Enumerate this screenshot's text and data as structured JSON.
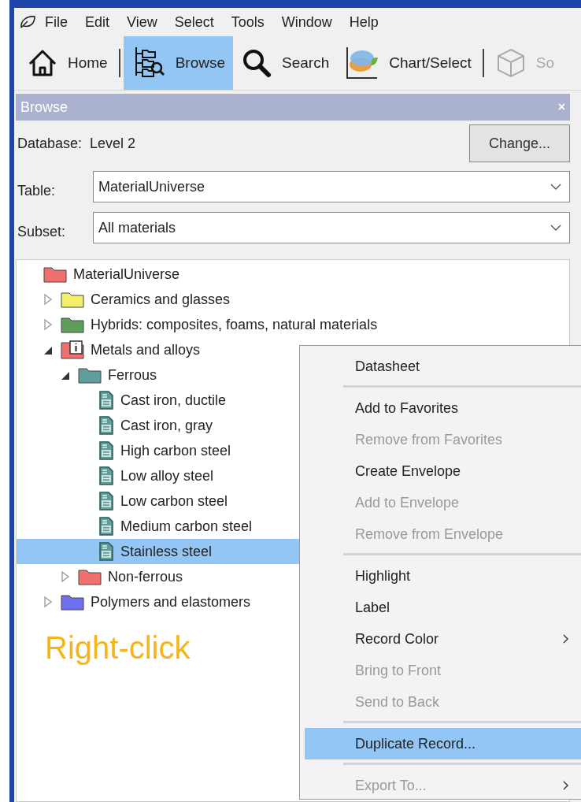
{
  "menu_bar": [
    "File",
    "Edit",
    "View",
    "Select",
    "Tools",
    "Window",
    "Help"
  ],
  "toolbar": [
    {
      "kind": "home",
      "label": "Home",
      "selected": false,
      "disabled": false,
      "divider_after": true
    },
    {
      "kind": "browse",
      "label": "Browse",
      "selected": true,
      "disabled": false,
      "divider_after": false
    },
    {
      "kind": "search",
      "label": "Search",
      "selected": false,
      "disabled": false,
      "divider_after": false
    },
    {
      "kind": "chart",
      "label": "Chart/Select",
      "selected": false,
      "disabled": false,
      "divider_after": true
    },
    {
      "kind": "cube",
      "label": "So",
      "selected": false,
      "disabled": true,
      "divider_after": false
    }
  ],
  "panel": {
    "title": "Browse",
    "close": "×",
    "database_label": "Database:",
    "database_value": "Level 2",
    "change_button": "Change...",
    "table_label": "Table:",
    "table_value": "MaterialUniverse",
    "subset_label": "Subset:",
    "subset_value": "All materials"
  },
  "tree": [
    {
      "label": "MaterialUniverse",
      "kind": "folder",
      "color": "#f07070",
      "selected": false,
      "children": [
        {
          "label": "Ceramics and glasses",
          "kind": "folder",
          "color": "#f3ef6a",
          "selected": false,
          "expanded": false
        },
        {
          "label": "Hybrids: composites, foams, natural materials",
          "kind": "folder",
          "color": "#5f9e5a",
          "selected": false,
          "expanded": false
        },
        {
          "label": "Metals and alloys",
          "kind": "info-folder",
          "color": "#f07070",
          "selected": false,
          "expanded": true,
          "children": [
            {
              "label": "Ferrous",
              "kind": "folder",
              "color": "#5f9e9a",
              "selected": false,
              "expanded": true,
              "children": [
                {
                  "label": "Cast iron, ductile",
                  "kind": "record",
                  "selected": false
                },
                {
                  "label": "Cast iron, gray",
                  "kind": "record",
                  "selected": false
                },
                {
                  "label": "High carbon steel",
                  "kind": "record",
                  "selected": false
                },
                {
                  "label": "Low alloy steel",
                  "kind": "record",
                  "selected": false
                },
                {
                  "label": "Low carbon steel",
                  "kind": "record",
                  "selected": false
                },
                {
                  "label": "Medium carbon steel",
                  "kind": "record",
                  "selected": false
                },
                {
                  "label": "Stainless steel",
                  "kind": "record",
                  "selected": true
                }
              ]
            },
            {
              "label": "Non-ferrous",
              "kind": "folder",
              "color": "#f07070",
              "selected": false,
              "expanded": false
            }
          ]
        },
        {
          "label": "Polymers and elastomers",
          "kind": "folder",
          "color": "#6f70f0",
          "selected": false,
          "expanded": false
        }
      ]
    }
  ],
  "annotation": "Right-click",
  "context_menu": [
    [
      {
        "label": "Datasheet",
        "disabled": false,
        "selected": false,
        "submenu": false
      }
    ],
    [
      {
        "label": "Add to Favorites",
        "disabled": false,
        "selected": false,
        "submenu": false
      },
      {
        "label": "Remove from Favorites",
        "disabled": true,
        "selected": false,
        "submenu": false
      },
      {
        "label": "Create Envelope",
        "disabled": false,
        "selected": false,
        "submenu": false
      },
      {
        "label": "Add to Envelope",
        "disabled": true,
        "selected": false,
        "submenu": false
      },
      {
        "label": "Remove from Envelope",
        "disabled": true,
        "selected": false,
        "submenu": false
      }
    ],
    [
      {
        "label": "Highlight",
        "disabled": false,
        "selected": false,
        "submenu": false
      },
      {
        "label": "Label",
        "disabled": false,
        "selected": false,
        "submenu": false
      },
      {
        "label": "Record Color",
        "disabled": false,
        "selected": false,
        "submenu": true
      },
      {
        "label": "Bring to Front",
        "disabled": true,
        "selected": false,
        "submenu": false
      },
      {
        "label": "Send to Back",
        "disabled": true,
        "selected": false,
        "submenu": false
      }
    ],
    [
      {
        "label": "Duplicate Record...",
        "disabled": false,
        "selected": true,
        "submenu": false
      }
    ],
    [
      {
        "label": "Export To...",
        "disabled": true,
        "selected": false,
        "submenu": true
      }
    ]
  ]
}
